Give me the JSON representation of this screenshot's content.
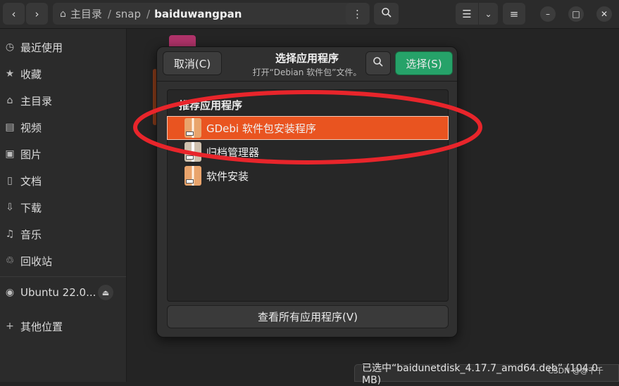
{
  "header": {
    "path": [
      "主目录",
      "snap",
      "baiduwangpan"
    ],
    "icons": [
      "chevron-left-icon",
      "chevron-right-icon",
      "home-icon",
      "more-vert-icon",
      "search-icon",
      "list-view-icon",
      "chevron-down-icon",
      "menu-icon",
      "minimize-icon",
      "maximize-icon",
      "close-icon"
    ]
  },
  "sidebar": {
    "items": [
      {
        "label": "最近使用",
        "icon": "clock-icon"
      },
      {
        "label": "收藏",
        "icon": "star-icon"
      },
      {
        "label": "主目录",
        "icon": "home-icon"
      },
      {
        "label": "视频",
        "icon": "film-icon"
      },
      {
        "label": "图片",
        "icon": "image-icon"
      },
      {
        "label": "文档",
        "icon": "document-icon"
      },
      {
        "label": "下载",
        "icon": "download-icon"
      },
      {
        "label": "音乐",
        "icon": "music-icon"
      },
      {
        "label": "回收站",
        "icon": "trash-icon"
      }
    ],
    "device": {
      "label": "Ubuntu 22.0...",
      "icon": "disk-icon"
    },
    "other": {
      "label": "其他位置",
      "icon": "plus-icon"
    }
  },
  "dialog": {
    "cancel_label": "取消(C)",
    "title": "选择应用程序",
    "subtitle": "打开“Debian 软件包”文件。",
    "select_label": "选择(S)",
    "list_heading": "推荐应用程序",
    "apps": [
      {
        "name": "GDebi 软件包安装程序",
        "selected": true
      },
      {
        "name": "归档管理器",
        "selected": false
      },
      {
        "name": "软件安装",
        "selected": false
      }
    ],
    "view_all_label": "查看所有应用程序(V)"
  },
  "status": {
    "text": "已选中“baidunetdisk_4.17.7_amd64.deb” (104.0 MB)"
  },
  "watermark": "CSDN @@千千",
  "colors": {
    "accent": "#e95420",
    "select_button": "#26a269",
    "annotation": "#e8252b"
  }
}
